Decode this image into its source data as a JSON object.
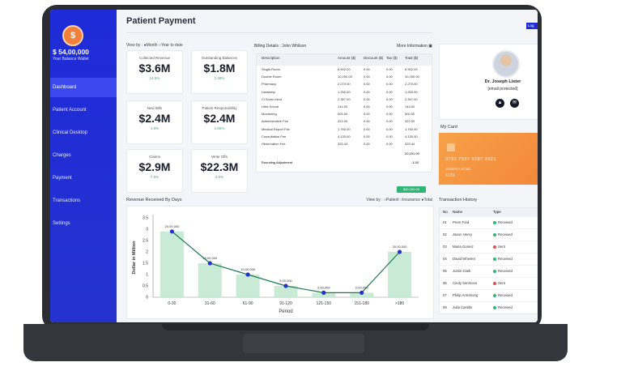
{
  "sidebar": {
    "balance": "$ 54,00,000",
    "balance_label": "Your Balance Wallet",
    "items": [
      {
        "label": "Dashboard"
      },
      {
        "label": "Patient Account"
      },
      {
        "label": "Clinical Desktop"
      },
      {
        "label": "Charges"
      },
      {
        "label": "Payment"
      },
      {
        "label": "Transactions"
      },
      {
        "label": "Settings"
      }
    ],
    "active_index": 0
  },
  "main": {
    "title": "Patient Payment",
    "view_by": {
      "label": "View by :",
      "options": [
        "Month",
        "Year to date"
      ],
      "selected": "Month"
    },
    "kpis": [
      {
        "label": "Collected Revenue",
        "value": "$3.6M",
        "pct": "14.5%"
      },
      {
        "label": "Outstanding Balances",
        "value": "$1.8M",
        "pct": "1.45%"
      },
      {
        "label": "New Bills",
        "value": "$2.4M",
        "pct": "1.9%"
      },
      {
        "label": "Patient Responsibility",
        "value": "$2.4M",
        "pct": "1.65%"
      },
      {
        "label": "Claims",
        "value": "$2.9M",
        "pct": "7.8%"
      },
      {
        "label": "Write Offs",
        "value": "$22.3M",
        "pct": "3.5%"
      }
    ],
    "billing": {
      "title": "Billing Details : John Whilson",
      "more": "More Information",
      "columns": [
        "Description",
        "Amount ($)",
        "Discount ($)",
        "Tax ($)",
        "Total ($)"
      ],
      "rows": [
        [
          "Single Room",
          "6,902.00",
          "0.00",
          "0.00",
          "6,902.00"
        ],
        [
          "Double Room",
          "10,250.00",
          "0.00",
          "0.00",
          "10,250.00"
        ],
        [
          "Pharmacy",
          "2,270.00",
          "0.00",
          "0.00",
          "2,270.00"
        ],
        [
          "Labaratry",
          "1,250.00",
          "0.00",
          "0.00",
          "1,250.00"
        ],
        [
          "Cl Scan/ mrcd",
          "2,357.00",
          "0.00",
          "0.00",
          "2,357.00"
        ],
        [
          "Ultra Sound",
          "144.00",
          "0.00",
          "0.00",
          "144.00"
        ],
        [
          "Monitoring",
          "500.00",
          "0.00",
          "0.00",
          "500.00"
        ],
        [
          "Administrative Fee",
          "322.00",
          "0.00",
          "0.00",
          "322.00"
        ],
        [
          "Medical Report Fee",
          "1,760.00",
          "0.00",
          "0.00",
          "1,760.00"
        ],
        [
          "Consultation Fee",
          "4,130.00",
          "0.00",
          "0.00",
          "4,130.00"
        ],
        [
          "Observation Fee",
          "320.44",
          "0.00",
          "0.00",
          "320.44"
        ]
      ],
      "grand_total": "20,151.00",
      "adjustment_label": "Rounding Adjustment",
      "adjustment_value": "-1.00",
      "pay_button": "$20,150.00"
    },
    "revenue": {
      "title": "Revenue Received By Days",
      "view_by_label": "View by :",
      "options": [
        "Patient",
        "Insurance",
        "Total"
      ],
      "selected": "Total"
    }
  },
  "right": {
    "logout": "Log",
    "doctor": "Dr. Joseph Lister",
    "email": "[email protected]",
    "icons": [
      "bell-icon",
      "mail-icon"
    ],
    "my_card_label": "My Card",
    "card": {
      "number": "3732 7537 5287 3921",
      "name": "JOSEPH LISTER",
      "expiry": "11/31"
    },
    "transactions": {
      "title": "Transaction History",
      "columns": [
        "No",
        "Name",
        "Type"
      ],
      "rows": [
        [
          "01",
          "Prem Ford",
          "Received"
        ],
        [
          "02",
          "Jason Henry",
          "Received"
        ],
        [
          "03",
          "Maria Gomez",
          "Sent"
        ],
        [
          "04",
          "David Wheeler",
          "Received"
        ],
        [
          "05",
          "Justin Clark",
          "Received"
        ],
        [
          "06",
          "Cindy Simmons",
          "Sent"
        ],
        [
          "07",
          "Philip Armstrong",
          "Received"
        ],
        [
          "08",
          "Julia Castillo",
          "Received"
        ]
      ],
      "colors": {
        "received": "#2fb574",
        "sent": "#e0524f"
      }
    }
  },
  "chart_data": {
    "type": "line",
    "categories": [
      "0-30",
      "31-60",
      "61-90",
      "91-120",
      "121-150",
      "151-180",
      ">180"
    ],
    "values": [
      2.9,
      1.5,
      1.0,
      0.5,
      0.2,
      0.2,
      2.0
    ],
    "data_labels": [
      "20,00,000",
      "15,00,000",
      "10,00,000",
      "5,00,000",
      "2,50,000",
      "2,00,000",
      "20,00,000"
    ],
    "xlabel": "Period",
    "ylabel": "Dollar in Million",
    "ylim": [
      0,
      3.5
    ],
    "yticks": [
      "0",
      "0.5",
      "1",
      "1.5",
      "2",
      "2.5",
      "3",
      "3.5"
    ],
    "colors": {
      "line": "#1e7a4e",
      "marker": "#2433c9",
      "bar": "#bfe8cf"
    }
  }
}
